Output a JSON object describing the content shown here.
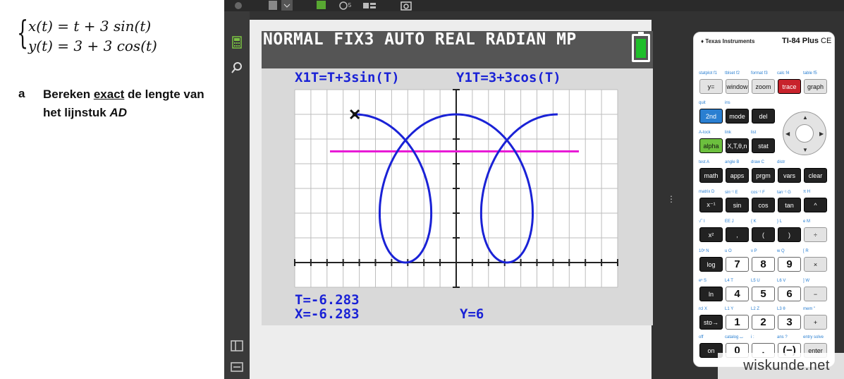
{
  "worksheet": {
    "eq1": "x(t) = t + 3 sin(t)",
    "eq2": "y(t) = 3 + 3 cos(t)",
    "task_letter": "a",
    "task_pre": "Bereken ",
    "task_exact": "exact",
    "task_mid": " de lengte van het lijnstuk ",
    "task_ad": "AD"
  },
  "toolbar": {
    "badge": "5"
  },
  "lcd": {
    "status": "NORMAL FIX3 AUTO REAL RADIAN MP",
    "x_eq": "X1T=T+3sin(T)",
    "y_eq": "Y1T=3+3cos(T)",
    "t_readout": "T=-6.283",
    "x_readout": "X=-6.283",
    "y_readout": "Y=6"
  },
  "colors": {
    "curve": "#1a22d6",
    "line": "#e81ad6",
    "battery": "#1fbf2a"
  },
  "chart_data": {
    "type": "line",
    "title": "",
    "x_param": "T+3sin(T)",
    "y_param": "3+3cos(T)",
    "t_range": [
      -6.283,
      6.283
    ],
    "xlim": [
      -10,
      10
    ],
    "ylim": [
      -1,
      7
    ],
    "horizontal_line_y": 4.5,
    "trace_point": {
      "t": -6.283,
      "x": -6.283,
      "y": 6
    },
    "grid": true
  },
  "calculator": {
    "brand": "Texas Instruments",
    "model": "TI-84 Plus",
    "model_suffix": "CE",
    "rows": [
      {
        "labels": [
          "statplot f1",
          "tblset f2",
          "format f3",
          "calc f4",
          "table f5"
        ],
        "keys": [
          "y=",
          "window",
          "zoom",
          "trace",
          "graph"
        ]
      },
      {
        "labels": [
          "quit",
          "ins"
        ],
        "keys": [
          "2nd",
          "mode",
          "del"
        ]
      },
      {
        "labels": [
          "A-lock",
          "link",
          "list"
        ],
        "keys": [
          "alpha",
          "X,T,θ,n",
          "stat"
        ]
      },
      {
        "labels": [
          "test A",
          "angle B",
          "draw C",
          "distr"
        ],
        "keys": [
          "math",
          "apps",
          "prgm",
          "vars",
          "clear"
        ]
      },
      {
        "labels": [
          "matrix D",
          "sin⁻¹ E",
          "cos⁻¹ F",
          "tan⁻¹ G",
          "π H"
        ],
        "keys": [
          "x⁻¹",
          "sin",
          "cos",
          "tan",
          "^"
        ]
      },
      {
        "labels": [
          "√‾ I",
          "EE J",
          "{ K",
          "} L",
          "e M"
        ],
        "keys": [
          "x²",
          ",",
          "(",
          ")",
          "÷"
        ]
      },
      {
        "labels": [
          "10ˣ N",
          "u O",
          "v P",
          "w Q",
          "[ R"
        ],
        "keys": [
          "log",
          "7",
          "8",
          "9",
          "×"
        ]
      },
      {
        "labels": [
          "eˣ S",
          "L4 T",
          "L5 U",
          "L6 V",
          "] W"
        ],
        "keys": [
          "ln",
          "4",
          "5",
          "6",
          "−"
        ]
      },
      {
        "labels": [
          "rcl X",
          "L1 Y",
          "L2 Z",
          "L3 θ",
          "mem \""
        ],
        "keys": [
          "sto→",
          "1",
          "2",
          "3",
          "+"
        ]
      },
      {
        "labels": [
          "off",
          "catalog ⌴",
          "i :",
          "ans ?",
          "entry solve"
        ],
        "keys": [
          "on",
          "0",
          ".",
          "(−)",
          "enter"
        ]
      }
    ]
  },
  "watermark": "wiskunde.net"
}
